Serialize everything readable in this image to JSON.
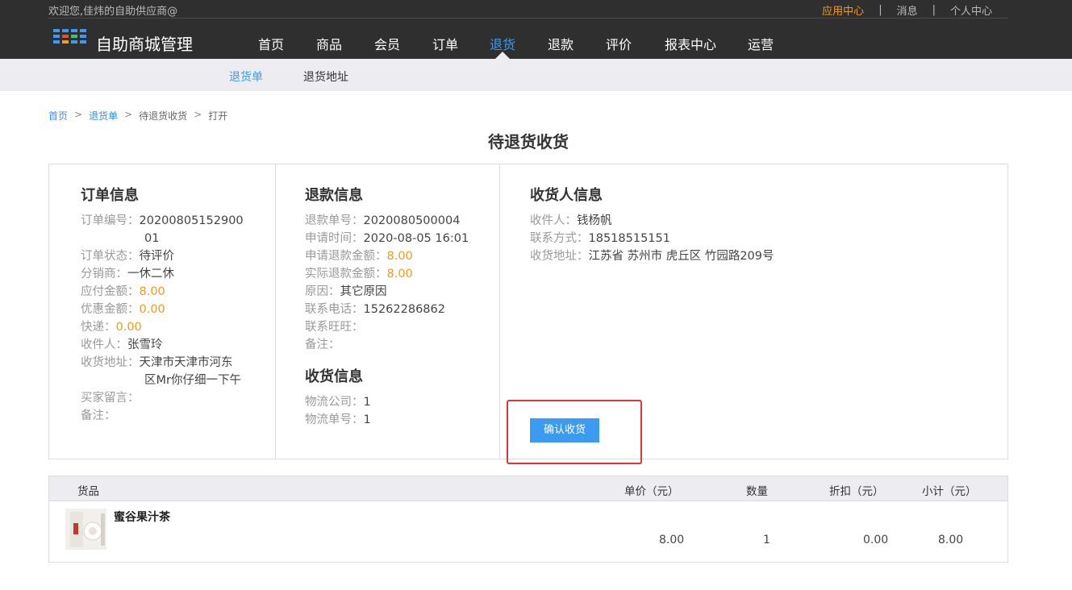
{
  "header": {
    "welcome": "欢迎您,佳炜的自助供应商@",
    "links": [
      "应用中心",
      "消息",
      "个人中心"
    ],
    "separator": "|",
    "brand": "自助商城管理",
    "nav": [
      "首页",
      "商品",
      "会员",
      "订单",
      "退货",
      "退款",
      "评价",
      "报表中心",
      "运营"
    ],
    "active_nav": "退货"
  },
  "subnav": [
    "退货单",
    "退货地址"
  ],
  "breadcrumb": [
    "首页",
    "退货单",
    "待退货收货",
    "打开"
  ],
  "breadcrumb_sep": ">",
  "page_title": "待退货收货",
  "order_info": {
    "title": "订单信息",
    "order_no_label": "订单编号：",
    "order_no_line1": "20200805152900",
    "order_no_line2": "01",
    "status_label": "订单状态：",
    "status": "待评价",
    "distributor_label": "分销商：",
    "distributor": "一休二休",
    "payable_label": "应付金额：",
    "payable": "8.00",
    "discount_label": "优惠金额：",
    "discount": "0.00",
    "express_label": "快递：",
    "express": "0.00",
    "receiver_label": "收件人：",
    "receiver": "张雪玲",
    "address_label": "收货地址：",
    "address_line1": "天津市天津市河东",
    "address_line2": "区Mr你仔细一下午",
    "buyer_note_label": "买家留言：",
    "buyer_note": "",
    "remark_label": "备注：",
    "remark": ""
  },
  "refund_info": {
    "title": "退款信息",
    "refund_no_label": "退款单号：",
    "refund_no": "2020080500004",
    "apply_time_label": "申请时间：",
    "apply_time": "2020-08-05 16:01",
    "apply_amount_label": "申请退款金额：",
    "apply_amount": "8.00",
    "actual_amount_label": "实际退款金额：",
    "actual_amount": "8.00",
    "reason_label": "原因：",
    "reason": "其它原因",
    "phone_label": "联系电话：",
    "phone": "15262286862",
    "wangwang_label": "联系旺旺：",
    "wangwang": "",
    "remark_label": "备注：",
    "remark": ""
  },
  "receipt_info": {
    "title": "收货信息",
    "logistics_label": "物流公司：",
    "logistics": "1",
    "tracking_label": "物流单号：",
    "tracking": "1"
  },
  "consignee_info": {
    "title": "收货人信息",
    "name_label": "收件人：",
    "name": "钱杨帆",
    "contact_label": "联系方式：",
    "contact": "18518515151",
    "address_label": "收货地址：",
    "address": "江苏省 苏州市 虎丘区 竹园路209号"
  },
  "confirm_button": "确认收货",
  "goods_table": {
    "headers": [
      "货品",
      "单价（元）",
      "数量",
      "折扣（元）",
      "小计（元）"
    ],
    "rows": [
      {
        "name": "蜜谷果汁茶",
        "price": "8.00",
        "qty": "1",
        "discount": "0.00",
        "subtotal": "8.00"
      }
    ]
  },
  "colors": {
    "accent": "#3a9bf0",
    "orange": "#f39a1e",
    "highlight_box": "#e23434",
    "topbar": "#2f2f2f"
  }
}
